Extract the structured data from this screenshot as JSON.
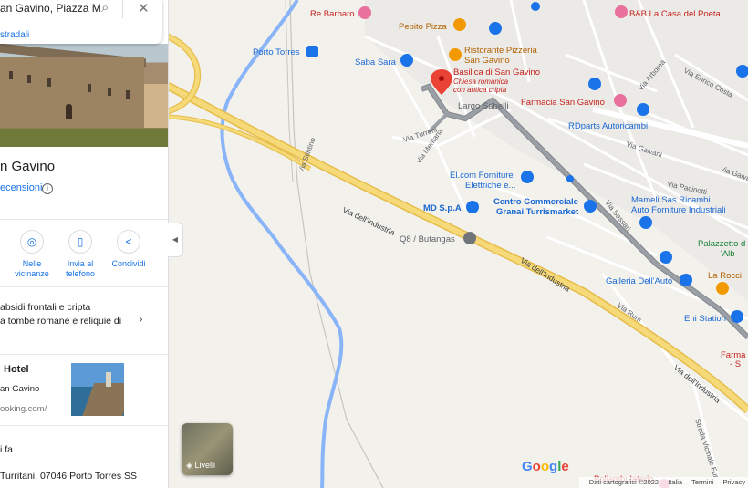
{
  "search": {
    "query": "an Gavino, Piazza M",
    "route_label": "stradali",
    "search_icon": "search-icon",
    "close_icon": "close-icon"
  },
  "place": {
    "title": "n Gavino",
    "reviews_label": "ecensioni"
  },
  "actions": [
    {
      "icon": "nearby-icon",
      "label1": "Nelle",
      "label2": "vicinanze"
    },
    {
      "icon": "phone-icon",
      "label1": "Invia al",
      "label2": "telefono"
    },
    {
      "icon": "share-icon",
      "label1": "Condividi",
      "label2": ""
    }
  ],
  "description": {
    "line1": "absidi frontali e cripta",
    "line2": "a tombe romane e reliquie di"
  },
  "hotel": {
    "title": "Hotel",
    "subtitle": "an Gavino",
    "url": "ooking.com/"
  },
  "footer": {
    "ago": "i fa",
    "address": "Turritani, 07046 Porto Torres SS"
  },
  "layers_label": "Livelli",
  "google_logo": "Google",
  "attribution": {
    "data": "Dati cartografici ©2022",
    "country": "Italia",
    "terms": "Termini",
    "privacy": "Privacy"
  },
  "map_labels": {
    "re_barbaro": "Re Barbaro",
    "pepito": "Pepito Pizza",
    "bb": "B&B La Casa del Poeta",
    "ristorante1": "Ristorante Pizzeria",
    "ristorante2": "San Gavino",
    "porto_torres": "Porto Torres",
    "saba_sara": "Saba Sara",
    "basilica": "Basilica di San Gavino",
    "basilica_sub1": "Chiesa romanica",
    "basilica_sub2": "con antica cripta",
    "farmacia": "Farmacia San Gavino",
    "largo": "Largo Sabelli",
    "rdparts": "RDparts Autoricambi",
    "via_turreni": "Via Turreni",
    "via_mentana": "Via Mentana",
    "via_stintino": "Via Stintino",
    "via_arborea": "Via Arborea",
    "via_enrico": "Via Enrico Costa",
    "via_galvani": "Via Galvani",
    "via_galva": "Via Galva",
    "via_pacinotti": "Via Pacinotti",
    "elcom1": "El.com Forniture",
    "elcom2": "Elettriche e...",
    "md": "MD S.p.A",
    "centro1": "Centro Commerciale",
    "centro2": "Granai Turrismarket",
    "mameli1": "Mameli Sas Ricambi",
    "mameli2": "Auto Forniture Industriali",
    "via_sassari": "Via Sassari",
    "via_industria": "Via dell'Industria",
    "q8": "Q8 / Butangas",
    "palazzetto1": "Palazzetto d",
    "palazzetto2": "'Alb",
    "galleria": "Galleria Dell'Auto",
    "rocci": "La Rocci",
    "via_rum": "Via Rum",
    "eni": "Eni Station",
    "farma1": "Farma",
    "farma2": "- S",
    "strada1": "Strada Vicinale Fur",
    "poliamb": "Poliambulatorio"
  },
  "colors": {
    "road_main": "#f6d978",
    "road_main_edge": "#e6bd4b",
    "water": "#8ab4f8",
    "route": "#9aa0a6",
    "pin": "#ea4335",
    "blue_poi": "#1a73e8",
    "orange_poi": "#f29900",
    "pink_poi": "#e8709a"
  }
}
